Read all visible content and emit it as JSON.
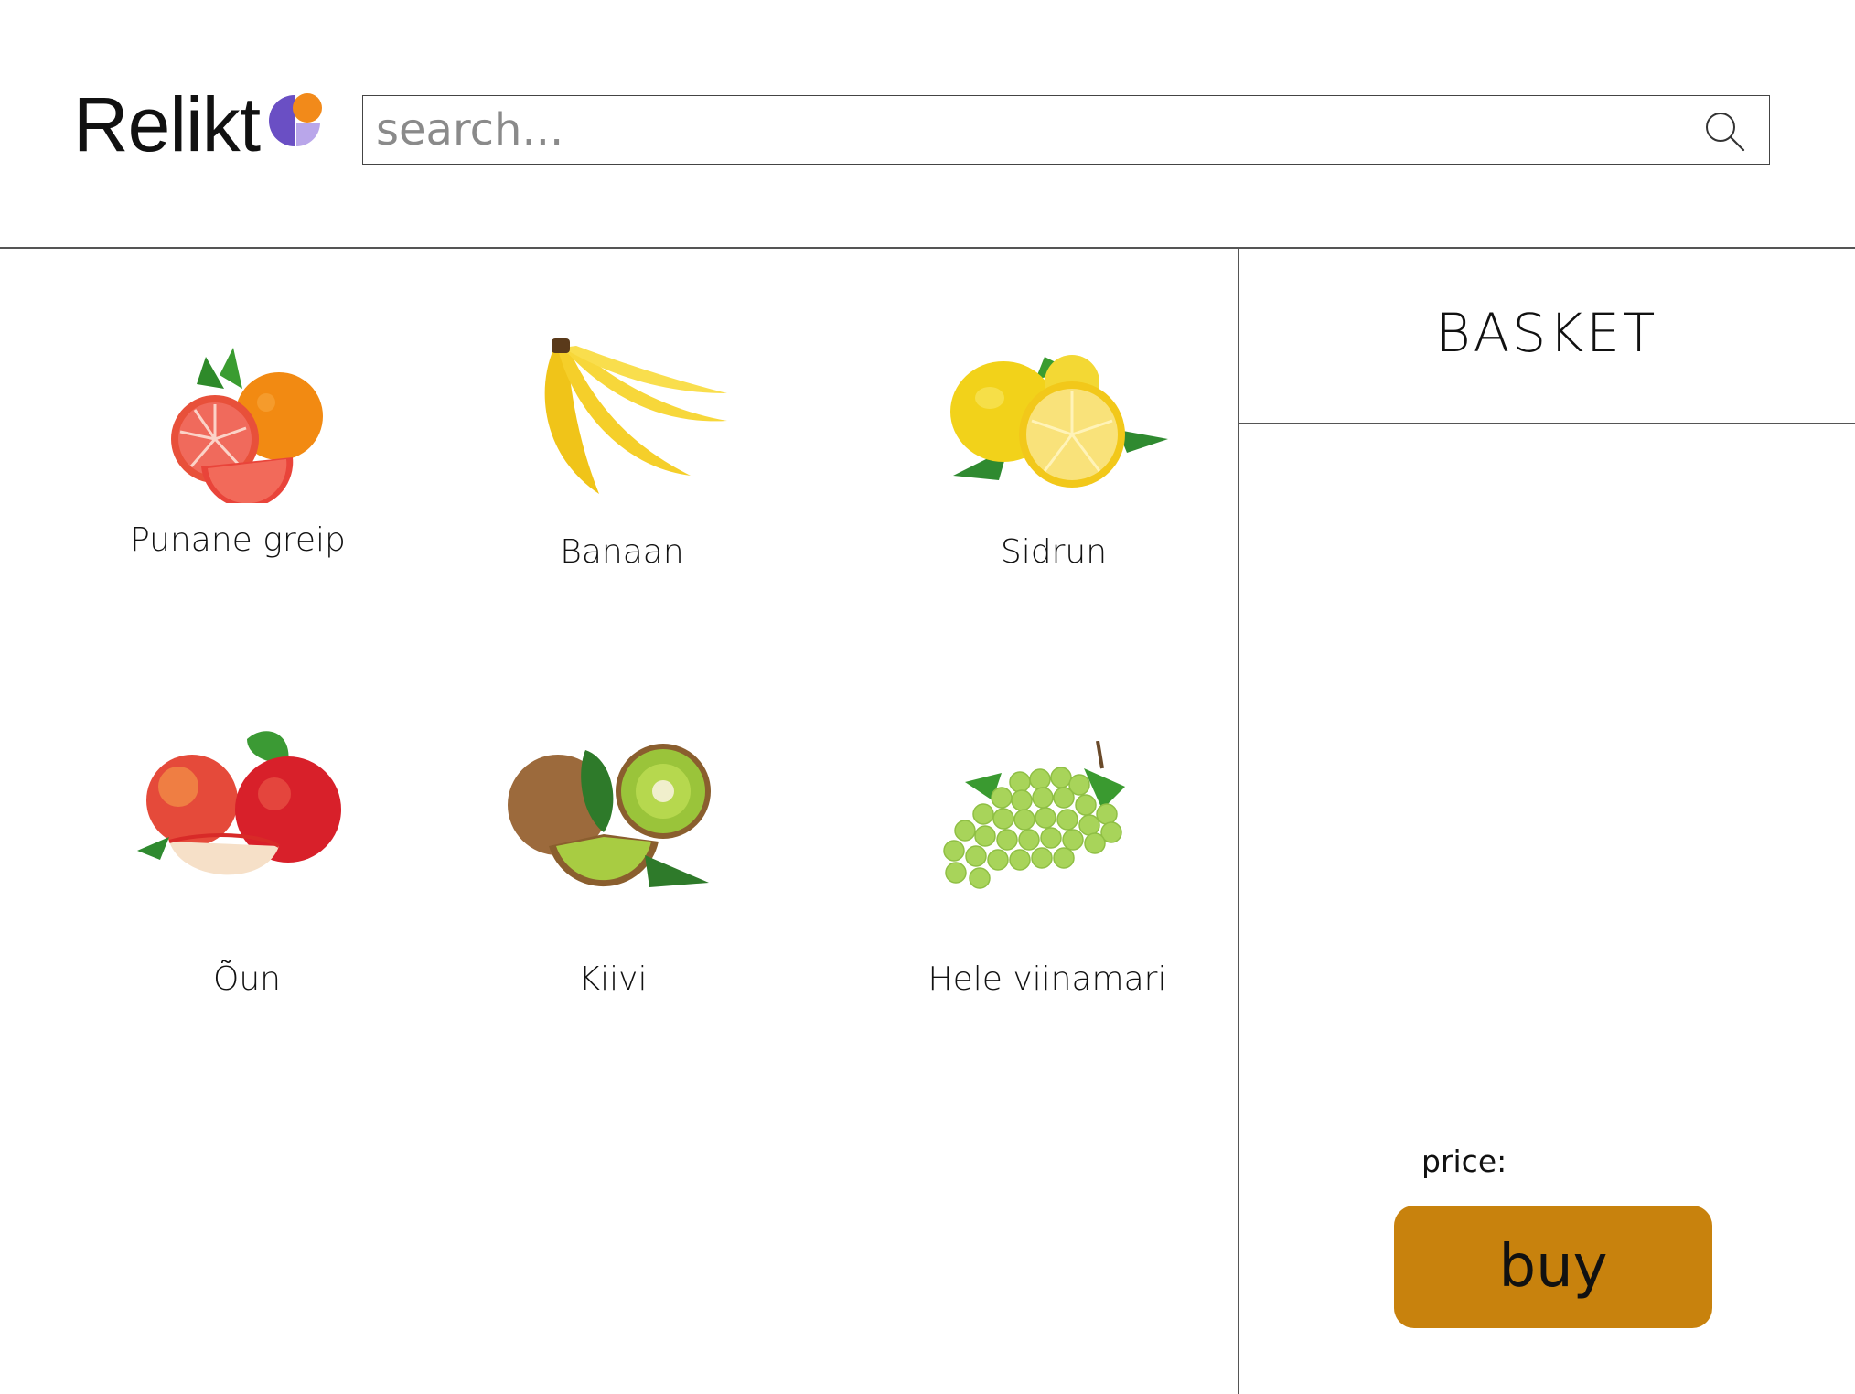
{
  "header": {
    "logo_text": "Relikt",
    "logo_icon": "relikt-logo-icon",
    "search": {
      "placeholder": "search...",
      "value": "",
      "icon": "search-icon"
    }
  },
  "products": [
    {
      "name": "Punane greip",
      "icon": "grapefruit-image"
    },
    {
      "name": "Banaan",
      "icon": "banana-image"
    },
    {
      "name": "Sidrun",
      "icon": "lemon-image"
    },
    {
      "name": "Õun",
      "icon": "apple-image"
    },
    {
      "name": "Kiivi",
      "icon": "kiwi-image"
    },
    {
      "name": "Hele viinamari",
      "icon": "grapes-image"
    }
  ],
  "basket": {
    "title": "BASKET",
    "price_label": "price:",
    "buy_label": "buy"
  },
  "colors": {
    "buy_button": "#c8820d",
    "logo_orange": "#f28a1a",
    "logo_purple": "#6a4fc4",
    "logo_lavender": "#b9a6ea"
  }
}
